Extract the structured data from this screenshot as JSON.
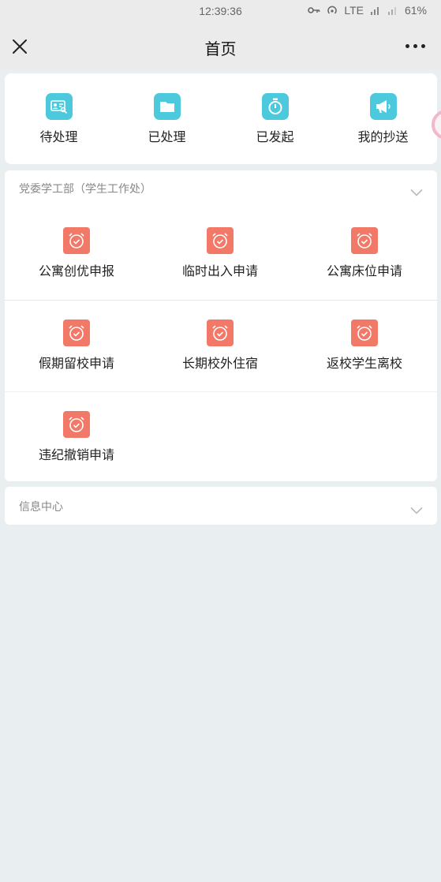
{
  "status_bar": {
    "time": "12:39:36",
    "network": "LTE",
    "battery": "61%"
  },
  "nav": {
    "title": "首页"
  },
  "quick_actions": [
    {
      "label": "待处理",
      "icon": "id-card-search-icon"
    },
    {
      "label": "已处理",
      "icon": "folder-icon"
    },
    {
      "label": "已发起",
      "icon": "stopwatch-icon"
    },
    {
      "label": "我的抄送",
      "icon": "megaphone-icon"
    }
  ],
  "department": {
    "title": "党委学工部（学生工作处）",
    "items": [
      {
        "label": "公寓创优申报"
      },
      {
        "label": "临时出入申请"
      },
      {
        "label": "公寓床位申请"
      },
      {
        "label": "假期留校申请"
      },
      {
        "label": "长期校外住宿"
      },
      {
        "label": "返校学生离校"
      },
      {
        "label": "违纪撤销申请"
      }
    ]
  },
  "info_center": {
    "title": "信息中心"
  },
  "colors": {
    "quick_icon": "#4cc9dc",
    "service_icon": "#f27868",
    "background": "#e9eef1"
  }
}
